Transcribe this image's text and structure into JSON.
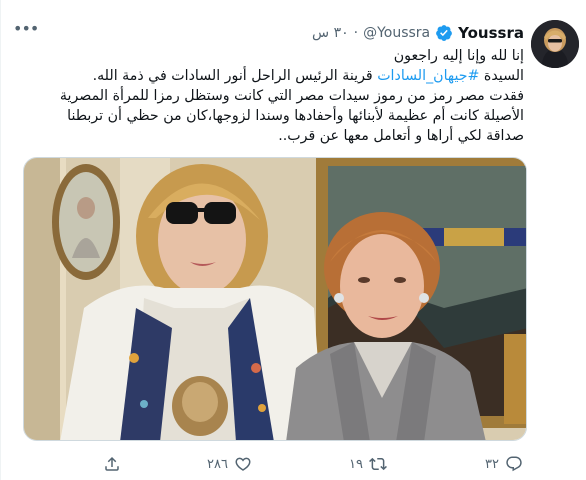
{
  "tweet": {
    "author_name": "Youssra",
    "handle": "@Youssra",
    "dot": "·",
    "time": "٣٠ س",
    "text_lines": [
      "إنا لله وإنا إليه راجعون",
      "السيدة",
      "قرينة الرئيس الراحل أنور السادات في ذمة الله.",
      "فقدت مصر رمز من رموز سيدات مصر التي كانت وستظل رمزا للمرأة المصرية",
      "الأصيلة كانت أم عظيمة لأبنائها وأحفادها وسندا لزوجها،كان من حظي أن تربطنا",
      "صداقة لكي أراها و أتعامل معها عن قرب.."
    ],
    "hashtag": "#جيهان_السادات",
    "replies": "٣٢",
    "retweets": "١٩",
    "likes": "٢٨٦"
  },
  "colors": {
    "accent": "#1d9bf0",
    "secondary_text": "#536471"
  },
  "icons": {
    "more": "more-horizontal-icon",
    "verified": "verified-badge-icon",
    "reply": "reply-icon",
    "retweet": "retweet-icon",
    "like": "heart-icon",
    "share": "share-icon"
  }
}
